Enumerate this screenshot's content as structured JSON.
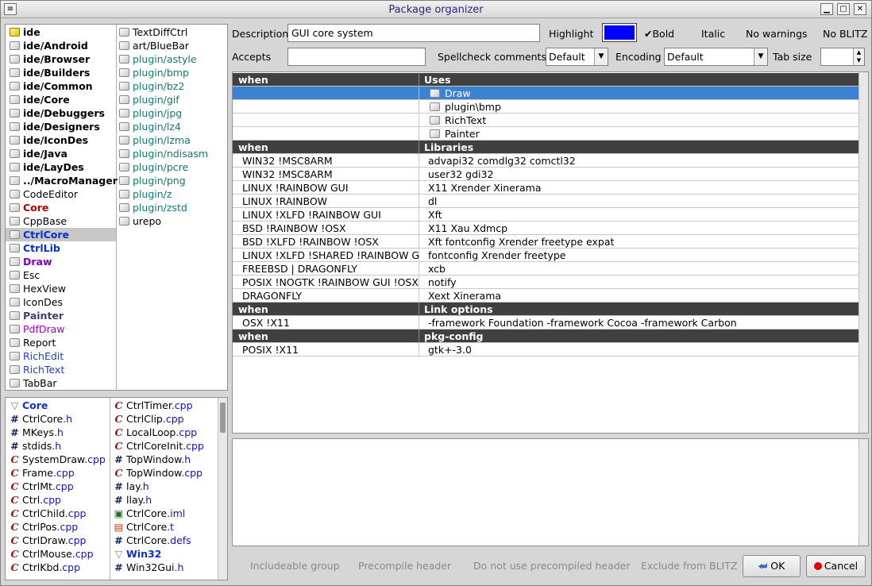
{
  "window": {
    "title": "Package organizer"
  },
  "packages": [
    {
      "label": "ide",
      "style": "b",
      "icon": "yellow-package-icon"
    },
    {
      "label": "ide/Android",
      "style": "b",
      "icon": "package-icon"
    },
    {
      "label": "ide/Browser",
      "style": "b",
      "icon": "package-icon"
    },
    {
      "label": "ide/Builders",
      "style": "b",
      "icon": "package-icon"
    },
    {
      "label": "ide/Common",
      "style": "b",
      "icon": "package-icon"
    },
    {
      "label": "ide/Core",
      "style": "b",
      "icon": "package-icon"
    },
    {
      "label": "ide/Debuggers",
      "style": "b",
      "icon": "package-icon"
    },
    {
      "label": "ide/Designers",
      "style": "b",
      "icon": "package-icon"
    },
    {
      "label": "ide/IconDes",
      "style": "b",
      "icon": "package-icon"
    },
    {
      "label": "ide/Java",
      "style": "b",
      "icon": "package-icon"
    },
    {
      "label": "ide/LayDes",
      "style": "b",
      "icon": "package-icon"
    },
    {
      "label": "../MacroManager",
      "style": "b",
      "icon": "package-icon"
    },
    {
      "label": "CodeEditor",
      "style": "",
      "icon": "package-icon"
    },
    {
      "label": "Core",
      "style": "red",
      "icon": "package-icon"
    },
    {
      "label": "CppBase",
      "style": "",
      "icon": "package-icon"
    },
    {
      "label": "CtrlCore",
      "style": "blue sel",
      "icon": "package-icon"
    },
    {
      "label": "CtrlLib",
      "style": "blue",
      "icon": "package-icon"
    },
    {
      "label": "Draw",
      "style": "purple",
      "icon": "package-icon"
    },
    {
      "label": "Esc",
      "style": "",
      "icon": "package-icon"
    },
    {
      "label": "HexView",
      "style": "",
      "icon": "package-icon"
    },
    {
      "label": "IconDes",
      "style": "",
      "icon": "package-icon"
    },
    {
      "label": "Painter",
      "style": "painter",
      "icon": "package-icon"
    },
    {
      "label": "PdfDraw",
      "style": "pdf",
      "icon": "package-icon"
    },
    {
      "label": "Report",
      "style": "",
      "icon": "package-icon"
    },
    {
      "label": "RichEdit",
      "style": "richedit",
      "icon": "package-icon"
    },
    {
      "label": "RichText",
      "style": "richtext",
      "icon": "package-icon"
    },
    {
      "label": "TabBar",
      "style": "",
      "icon": "package-icon"
    }
  ],
  "packages2": [
    {
      "label": "TextDiffCtrl",
      "style": ""
    },
    {
      "label": "art/BlueBar",
      "style": ""
    },
    {
      "label": "plugin/astyle",
      "style": "teal"
    },
    {
      "label": "plugin/bmp",
      "style": "teal"
    },
    {
      "label": "plugin/bz2",
      "style": "teal"
    },
    {
      "label": "plugin/gif",
      "style": "teal"
    },
    {
      "label": "plugin/jpg",
      "style": "teal"
    },
    {
      "label": "plugin/lz4",
      "style": "teal"
    },
    {
      "label": "plugin/lzma",
      "style": "teal"
    },
    {
      "label": "plugin/ndisasm",
      "style": "teal"
    },
    {
      "label": "plugin/pcre",
      "style": "teal"
    },
    {
      "label": "plugin/png",
      "style": "teal"
    },
    {
      "label": "plugin/z",
      "style": "teal"
    },
    {
      "label": "plugin/zstd",
      "style": "teal"
    },
    {
      "label": "urepo",
      "style": ""
    }
  ],
  "files1": [
    {
      "icon": "folder-arrow-icon",
      "glyph": "▽",
      "name": "Core",
      "ext": "",
      "bold": true
    },
    {
      "icon": "header-file-icon",
      "glyph": "#",
      "name": "CtrlCore",
      "ext": ".h"
    },
    {
      "icon": "header-file-icon",
      "glyph": "#",
      "name": "MKeys",
      "ext": ".h"
    },
    {
      "icon": "header-file-icon",
      "glyph": "#",
      "name": "stdids",
      "ext": ".h"
    },
    {
      "icon": "cpp-file-icon",
      "glyph": "C",
      "name": "SystemDraw",
      "ext": ".cpp"
    },
    {
      "icon": "cpp-file-icon",
      "glyph": "C",
      "name": "Frame",
      "ext": ".cpp"
    },
    {
      "icon": "cpp-file-icon",
      "glyph": "C",
      "name": "CtrlMt",
      "ext": ".cpp"
    },
    {
      "icon": "cpp-file-icon",
      "glyph": "C",
      "name": "Ctrl",
      "ext": ".cpp"
    },
    {
      "icon": "cpp-file-icon",
      "glyph": "C",
      "name": "CtrlChild",
      "ext": ".cpp"
    },
    {
      "icon": "cpp-file-icon",
      "glyph": "C",
      "name": "CtrlPos",
      "ext": ".cpp"
    },
    {
      "icon": "cpp-file-icon",
      "glyph": "C",
      "name": "CtrlDraw",
      "ext": ".cpp"
    },
    {
      "icon": "cpp-file-icon",
      "glyph": "C",
      "name": "CtrlMouse",
      "ext": ".cpp"
    },
    {
      "icon": "cpp-file-icon",
      "glyph": "C",
      "name": "CtrlKbd",
      "ext": ".cpp"
    }
  ],
  "files2": [
    {
      "icon": "cpp-file-icon",
      "glyph": "C",
      "name": "CtrlTimer",
      "ext": ".cpp"
    },
    {
      "icon": "cpp-file-icon",
      "glyph": "C",
      "name": "CtrlClip",
      "ext": ".cpp"
    },
    {
      "icon": "cpp-file-icon",
      "glyph": "C",
      "name": "LocalLoop",
      "ext": ".cpp"
    },
    {
      "icon": "cpp-file-icon",
      "glyph": "C",
      "name": "CtrlCoreInit",
      "ext": ".cpp"
    },
    {
      "icon": "header-file-icon",
      "glyph": "#",
      "name": "TopWindow",
      "ext": ".h"
    },
    {
      "icon": "cpp-file-icon",
      "glyph": "C",
      "name": "TopWindow",
      "ext": ".cpp"
    },
    {
      "icon": "header-file-icon",
      "glyph": "#",
      "name": "lay",
      "ext": ".h"
    },
    {
      "icon": "header-file-icon",
      "glyph": "#",
      "name": "llay",
      "ext": ".h"
    },
    {
      "icon": "image-file-icon",
      "glyph": "▣",
      "name": "CtrlCore",
      "ext": ".iml"
    },
    {
      "icon": "translation-file-icon",
      "glyph": "▤",
      "name": "CtrlCore",
      "ext": ".t"
    },
    {
      "icon": "defs-file-icon",
      "glyph": "#",
      "name": "CtrlCore",
      "ext": ".defs"
    },
    {
      "icon": "folder-arrow-icon",
      "glyph": "▽",
      "name": "Win32",
      "ext": "",
      "bold": true
    },
    {
      "icon": "header-file-icon",
      "glyph": "#",
      "name": "Win32Gui",
      "ext": ".h"
    }
  ],
  "form": {
    "description_label": "Description",
    "description_value": "GUI core system",
    "highlight_label": "Highlight",
    "highlight_color": "#0000ff",
    "bold_label": "Bold",
    "italic_label": "Italic",
    "no_warnings_label": "No warnings",
    "no_blitz_label": "No BLITZ",
    "accepts_label": "Accepts",
    "accepts_value": "",
    "spellcheck_label": "Spellcheck comments",
    "spellcheck_value": "Default",
    "encoding_label": "Encoding",
    "encoding_value": "Default",
    "tabsize_label": "Tab size",
    "tabsize_value": ""
  },
  "grid": [
    {
      "type": "hdr",
      "c1": "when",
      "c2": "Uses"
    },
    {
      "type": "use hi",
      "c1": "",
      "c2": "Draw"
    },
    {
      "type": "use",
      "c1": "",
      "c2": "plugin\\bmp"
    },
    {
      "type": "use",
      "c1": "",
      "c2": "RichText"
    },
    {
      "type": "use",
      "c1": "",
      "c2": "Painter"
    },
    {
      "type": "hdr",
      "c1": "when",
      "c2": "Libraries"
    },
    {
      "type": "",
      "c1": "WIN32 !MSC8ARM",
      "c2": "advapi32 comdlg32 comctl32"
    },
    {
      "type": "",
      "c1": "WIN32 !MSC8ARM",
      "c2": "user32 gdi32"
    },
    {
      "type": "",
      "c1": "LINUX !RAINBOW GUI",
      "c2": "X11 Xrender Xinerama"
    },
    {
      "type": "",
      "c1": "LINUX  !RAINBOW",
      "c2": "dl"
    },
    {
      "type": "",
      "c1": "LINUX !XLFD  !RAINBOW GUI",
      "c2": "Xft"
    },
    {
      "type": "",
      "c1": "BSD !RAINBOW !OSX",
      "c2": "X11  Xau Xdmcp"
    },
    {
      "type": "",
      "c1": "BSD !XLFD  !RAINBOW !OSX",
      "c2": "Xft fontconfig Xrender freetype expat"
    },
    {
      "type": "",
      "c1": "LINUX !XLFD !SHARED  !RAINBOW GUI",
      "c2": "fontconfig Xrender freetype"
    },
    {
      "type": "",
      "c1": "FREEBSD | DRAGONFLY",
      "c2": "xcb"
    },
    {
      "type": "",
      "c1": "POSIX !NOGTK !RAINBOW GUI !OSX",
      "c2": "notify"
    },
    {
      "type": "",
      "c1": "DRAGONFLY",
      "c2": "Xext Xinerama"
    },
    {
      "type": "hdr",
      "c1": "when",
      "c2": "Link options"
    },
    {
      "type": "",
      "c1": "OSX !X11",
      "c2": "-framework Foundation -framework Cocoa -framework Carbon"
    },
    {
      "type": "hdr",
      "c1": "when",
      "c2": "pkg-config"
    },
    {
      "type": "",
      "c1": "POSIX !X11",
      "c2": "gtk+-3.0"
    }
  ],
  "bottom": {
    "includeable": "Includeable group",
    "precompile": "Precompile header",
    "no_precompiled": "Do not use precompiled header",
    "exclude_blitz": "Exclude from BLITZ",
    "ok": "OK",
    "cancel": "Cancel"
  }
}
